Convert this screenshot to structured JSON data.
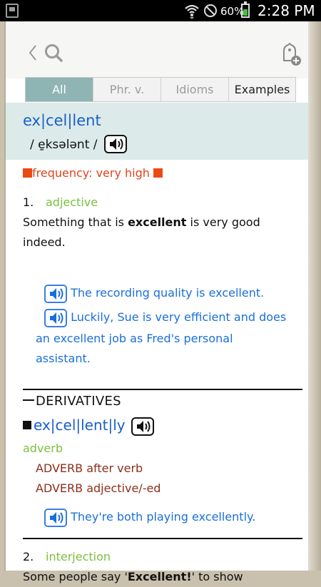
{
  "status_bar": {
    "battery_text": "60%",
    "battery_level": 0.6,
    "time": "2:28 PM",
    "icons": [
      "sim-card-icon",
      "wifi-icon",
      "no-sync-icon",
      "battery-icon"
    ]
  },
  "toolbar": {
    "icons": [
      "back-arrow-icon",
      "search-icon",
      "add-to-wordbook-icon"
    ]
  },
  "tabs": [
    {
      "label": "All",
      "active": true
    },
    {
      "label": "Phr. v.",
      "active": false
    },
    {
      "label": "Idioms",
      "active": false
    },
    {
      "label": "Examples",
      "active": false
    }
  ],
  "entry": {
    "headword": "ex|cel|lent",
    "pronunciation": "/ e̱ksələnt /",
    "frequency": "frequency: very high",
    "senses": [
      {
        "number": "1.",
        "pos": "adjective",
        "definition_pre": "Something that is ",
        "definition_bold": "excellent",
        "definition_post": " is very good",
        "definition_line2": "indeed.",
        "examples": [
          {
            "line1": "The recording quality is excellent."
          },
          {
            "line1": "Luckily, Sue is very efficient and does",
            "line2": "an excellent job as Fred's personal",
            "line3": "assistant."
          }
        ]
      },
      {
        "number": "2.",
        "pos": "interjection",
        "definition_pre": "Some people say '",
        "definition_bold": "Excellent!",
        "definition_post": "' to show"
      }
    ],
    "derivatives": {
      "title": "DERIVATIVES",
      "word": "ex|cel|lent|ly",
      "pos": "adverb",
      "grammar": [
        "ADVERB after verb",
        "ADVERB adjective/-ed"
      ],
      "example": "They're both playing excellently."
    }
  },
  "colors": {
    "headword_blue": "#1a5fc8",
    "example_blue": "#1a6fd9",
    "pos_green": "#7bbf3f",
    "frequency_red": "#e0431c",
    "grammar_brown": "#8a2f1c",
    "tab_active": "#8fb4b4",
    "head_band": "#dcebe9"
  }
}
